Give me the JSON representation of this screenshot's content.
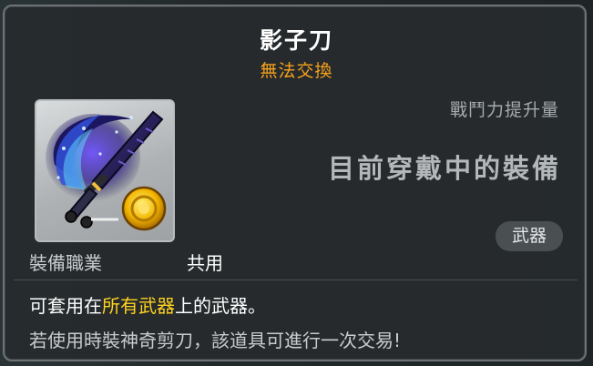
{
  "item": {
    "name": "影子刀",
    "trade_status": "無法交換",
    "icon": "shadow-blade-weapon-icon"
  },
  "stats": {
    "label": "戰鬥力提升量",
    "equipped_text": "目前穿戴中的裝備",
    "type_badge": "武器"
  },
  "job": {
    "label": "裝備職業",
    "value": "共用"
  },
  "description": {
    "prefix": "可套用在",
    "highlight": "所有武器",
    "suffix": "上的武器。",
    "note": "若使用時裝神奇剪刀，該道具可進行一次交易!"
  },
  "colors": {
    "title": "#ffffff",
    "trade_status": "#f7a21b",
    "highlight": "#ffd21e",
    "background": "#26292c",
    "border": "#6d7275"
  }
}
